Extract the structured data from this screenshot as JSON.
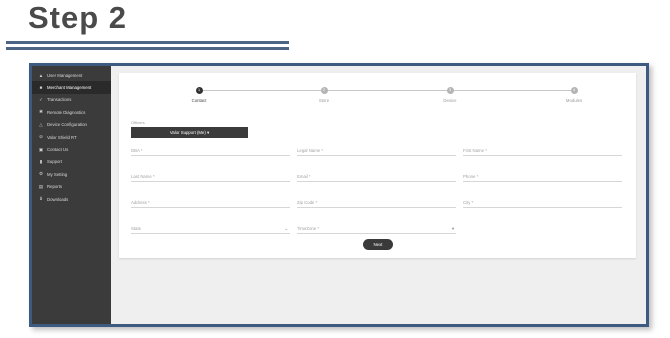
{
  "slide": {
    "title": "Step 2"
  },
  "sidebar": {
    "items": [
      {
        "label": "User Management",
        "icon": "users-icon"
      },
      {
        "label": "Merchant Management",
        "icon": "merchant-icon",
        "active": true
      },
      {
        "label": "Transactions",
        "icon": "check-icon"
      },
      {
        "label": "Remote Diagnostics",
        "icon": "diagnostics-icon"
      },
      {
        "label": "Device Configuration",
        "icon": "device-icon"
      },
      {
        "label": "Valor Shield RT",
        "icon": "shield-icon"
      },
      {
        "label": "Contact Us",
        "icon": "contact-icon"
      },
      {
        "label": "Support",
        "icon": "support-icon"
      },
      {
        "label": "My Setting",
        "icon": "settings-icon"
      },
      {
        "label": "Reports",
        "icon": "reports-icon"
      },
      {
        "label": "Downloads",
        "icon": "download-icon"
      }
    ]
  },
  "stepper": {
    "steps": [
      {
        "number": "1",
        "label": "Contact",
        "active": true
      },
      {
        "number": "2",
        "label": "Store"
      },
      {
        "number": "3",
        "label": "Device"
      },
      {
        "number": "4",
        "label": "Modules"
      }
    ]
  },
  "form": {
    "officer_label": "Officers",
    "officer_value": "Valor Support (Me) ▾",
    "dba_placeholder": "DBA *",
    "legal_name_placeholder": "Legal Name *",
    "first_name_placeholder": "First Name *",
    "last_name_placeholder": "Last Name *",
    "email_placeholder": "Email *",
    "phone_placeholder": "Phone *",
    "address_placeholder": "Address *",
    "zip_placeholder": "Zip Code *",
    "city_placeholder": "City *",
    "state_placeholder": "State",
    "timezone_placeholder": "TimeZone *",
    "state_arrow": "⌄",
    "timezone_arrow": "▾",
    "next_label": "Next"
  }
}
